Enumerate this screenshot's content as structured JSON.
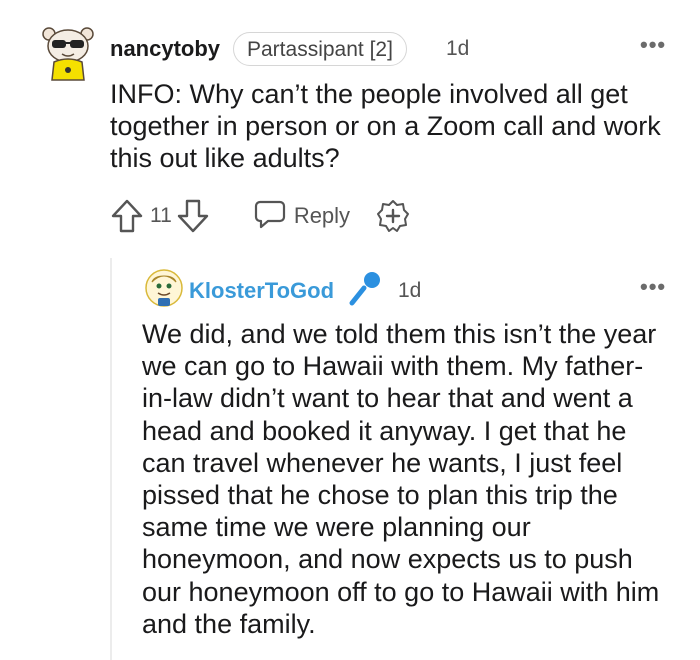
{
  "comment": {
    "username": "nancytoby",
    "flair": "Partassipant [2]",
    "time": "1d",
    "more": "•••",
    "text": "INFO: Why can’t the people involved all get together in person or on a Zoom call and work this out like adults?",
    "votes": "11",
    "reply_label": "Reply",
    "icons": [
      "avatar",
      "upvote-icon",
      "downvote-icon",
      "reply-bubble-icon",
      "award-add-icon",
      "more-icon"
    ]
  },
  "reply": {
    "username": "KlosterToGod",
    "time": "1d",
    "more": "•••",
    "text": "We did, and we told them this isn’t the year we can go to Hawaii with them. My father-in-law didn’t want to hear that and went a head and booked it anyway. I get that he can travel whenever he wants, I just feel pissed that he chose to plan this trip the same time we were planning our honeymoon, and now expects us to push our honeymoon off to go to Hawaii with him and the family.",
    "username_color": "#3a9ad9",
    "icons": [
      "avatar",
      "microphone-icon",
      "more-icon"
    ]
  }
}
